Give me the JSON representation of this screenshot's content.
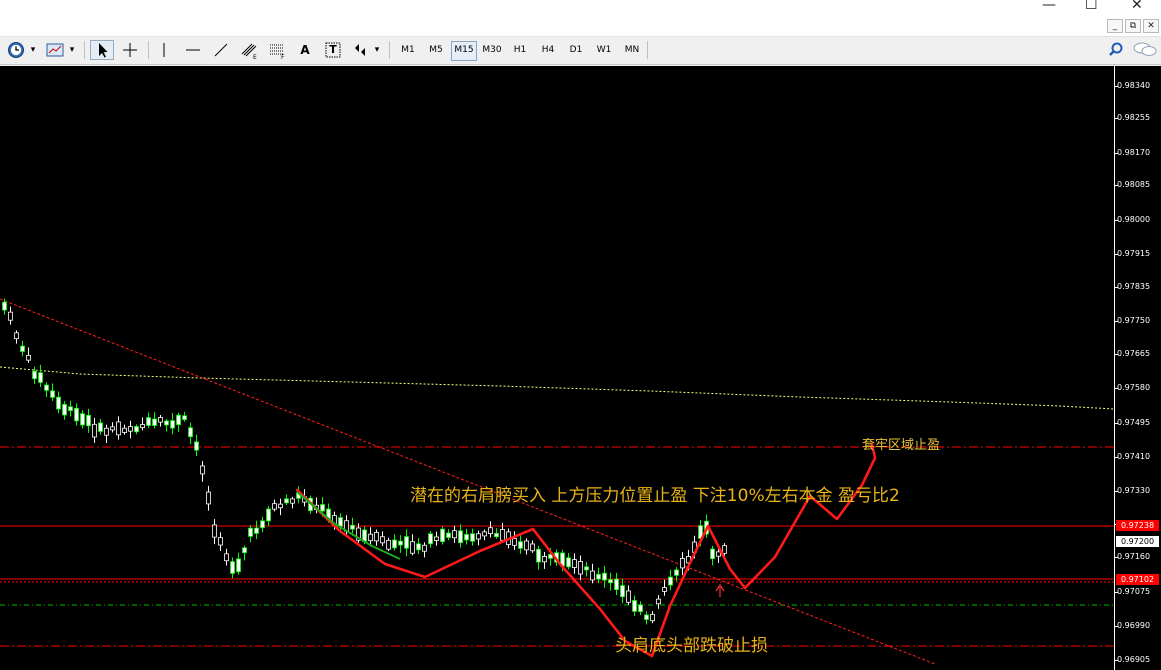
{
  "window": {
    "buttons": {
      "minimize": "—",
      "maximize": "☐",
      "close": "✕"
    },
    "mdi_buttons": {
      "minimize": "_",
      "restore": "⧉",
      "close": "✕"
    }
  },
  "toolbar": {
    "tools": [
      "clock-icon",
      "chart-template-icon",
      "cursor-icon",
      "crosshair-icon",
      "vertical-line-icon",
      "horizontal-line-icon",
      "trendline-icon",
      "equidistant-channel-icon",
      "fibonacci-icon",
      "text-icon",
      "text-label-icon",
      "arrow-shapes-icon"
    ],
    "text_tool": "A",
    "label_tool": "T",
    "timeframes": [
      "M1",
      "M5",
      "M15",
      "M30",
      "H1",
      "H4",
      "D1",
      "W1",
      "MN"
    ],
    "active_timeframe": "M15"
  },
  "chart_data": {
    "type": "candlestick",
    "price_scale": [
      "0.98340",
      "0.98255",
      "0.98170",
      "0.98085",
      "0.98000",
      "0.97915",
      "0.97835",
      "0.97750",
      "0.97665",
      "0.97580",
      "0.97495",
      "0.97410",
      "0.97330",
      "0.97245",
      "0.97160",
      "0.97075",
      "0.96990",
      "0.96905"
    ],
    "level_labels": {
      "resistance": "0.97238",
      "current": "0.97200",
      "support": "0.97102"
    },
    "colors": {
      "background": "#000000",
      "bull": "#ffffff",
      "bear": "#00ff00",
      "resistance_line": "#ff0000",
      "trendline": "#ff0000",
      "moving_average": "#ffff80",
      "hand_drawing": "#ff0000"
    },
    "annotations": {
      "top": "套牢区域止盈",
      "middle": "潜在的右肩膀买入 上方压力位置止盈 下注10%左右本金 盈亏比2",
      "bottom": "头肩底头部跌破止损"
    }
  }
}
